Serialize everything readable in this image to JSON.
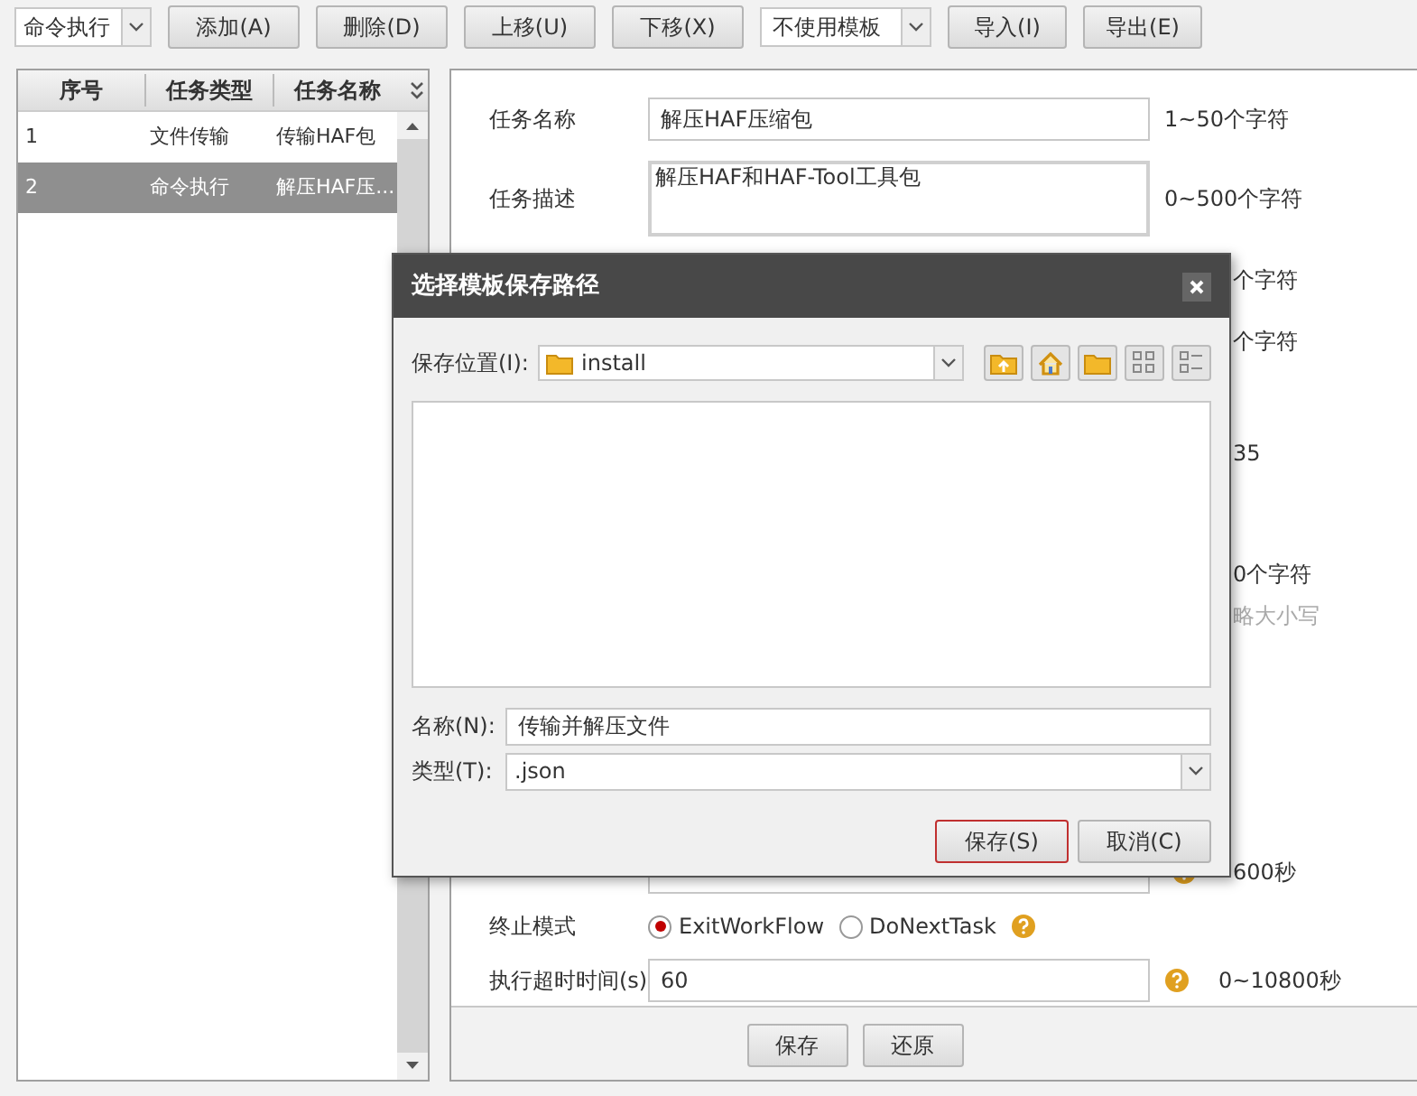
{
  "toolbar": {
    "type_select": "命令执行",
    "buttons": [
      "添加(A)",
      "删除(D)",
      "上移(U)",
      "下移(X)"
    ],
    "template_select": "不使用模板",
    "io_buttons": [
      "导入(I)",
      "导出(E)"
    ]
  },
  "task_table": {
    "columns": [
      "序号",
      "任务类型",
      "任务名称"
    ],
    "rows": [
      {
        "cells": [
          "1",
          "文件传输",
          "传输HAF包"
        ],
        "selected": false
      },
      {
        "cells": [
          "2",
          "命令执行",
          "解压HAF压..."
        ],
        "selected": true
      }
    ]
  },
  "form": {
    "rows": [
      {
        "kind": "text",
        "label": "任务名称",
        "value": "解压HAF压缩包",
        "help": false,
        "note": "1~50个字符"
      },
      {
        "kind": "textarea",
        "label": "任务描述",
        "value": "解压HAF和HAF-Tool工具包",
        "help": false,
        "note": "0~500个字符"
      },
      {
        "kind": "covered",
        "note": "个字符"
      },
      {
        "kind": "covered",
        "note": "个字符"
      },
      {
        "kind": "covered",
        "note": "35"
      },
      {
        "kind": "covered",
        "note": "0个字符",
        "subnote": "略大小写"
      },
      {
        "kind": "partial",
        "help": true,
        "note": "600秒"
      },
      {
        "kind": "radio",
        "label": "终止模式",
        "options": [
          {
            "label": "ExitWorkFlow",
            "selected": true
          },
          {
            "label": "DoNextTask",
            "selected": false
          }
        ],
        "help": true
      },
      {
        "kind": "text",
        "label": "执行超时时间(s)",
        "value": "60",
        "help": true,
        "note": "0~10800秒"
      }
    ],
    "buttons": [
      "保存",
      "还原"
    ]
  },
  "dialog": {
    "title": "选择模板保存路径",
    "location_label": "保存位置(I):",
    "location": "install",
    "name_label": "名称(N):",
    "name": "传输并解压文件",
    "type_label": "类型(T):",
    "type": ".json",
    "buttons": [
      {
        "label": "保存(S)",
        "default": true
      },
      {
        "label": "取消(C)",
        "default": false
      }
    ]
  }
}
